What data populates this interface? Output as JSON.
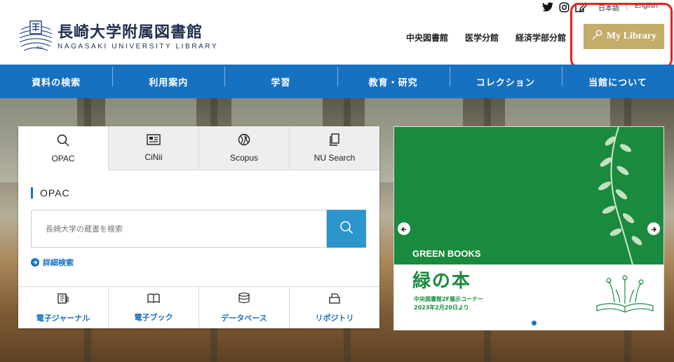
{
  "header": {
    "logo_jp": "長崎大学附属図書館",
    "logo_en": "NAGASAKI UNIVERSITY LIBRARY",
    "lang_ja": "日本語",
    "lang_en": "English",
    "branches": [
      "中央図書館",
      "医学分館",
      "経済学部分館"
    ],
    "mylibrary_label": "My Library"
  },
  "nav": {
    "items": [
      "資料の検索",
      "利用案内",
      "学習",
      "教育・研究",
      "コレクション",
      "当館について"
    ]
  },
  "search": {
    "tabs": [
      {
        "label": "OPAC",
        "icon": "search-icon"
      },
      {
        "label": "CiNii",
        "icon": "newspaper-icon"
      },
      {
        "label": "Scopus",
        "icon": "globe-icon"
      },
      {
        "label": "NU Search",
        "icon": "document-icon"
      }
    ],
    "active_tab": "OPAC",
    "panel_title": "OPAC",
    "placeholder": "長崎大学の蔵書を検索",
    "advanced_label": "詳細検索",
    "bottom_links": [
      {
        "label": "電子ジャーナル",
        "icon": "journal-icon"
      },
      {
        "label": "電子ブック",
        "icon": "book-icon"
      },
      {
        "label": "データベース",
        "icon": "database-icon"
      },
      {
        "label": "リポジトリ",
        "icon": "repository-icon"
      }
    ]
  },
  "banner": {
    "tag": "GREEN BOOKS",
    "title": "緑の本",
    "sub1": "中央図書館2F展示コーナー",
    "sub2": "2023年2月20日より"
  },
  "colors": {
    "nav_blue": "#1771c1",
    "search_button": "#2c95cb",
    "mylibrary_gold": "#c4ac6a",
    "banner_green": "#1a8a3e",
    "highlight_red": "#e8211b"
  }
}
